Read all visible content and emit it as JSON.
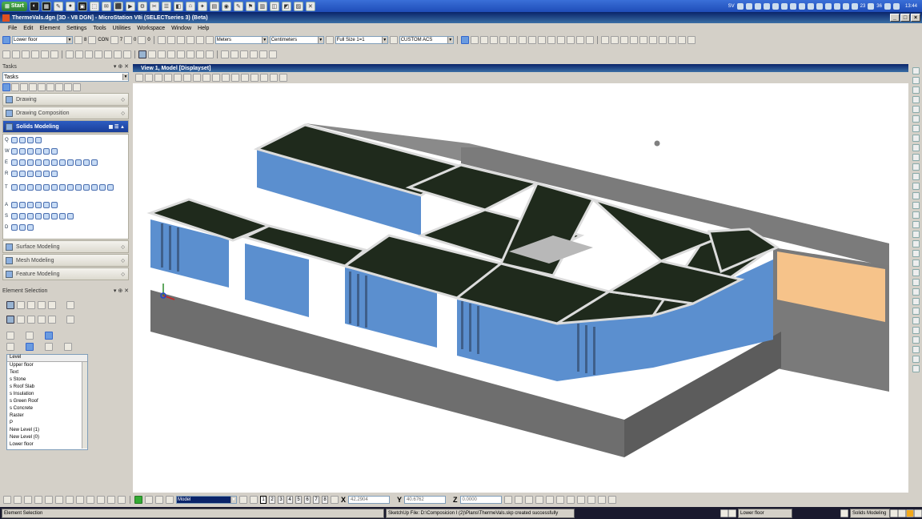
{
  "taskbar": {
    "start_label": "Start",
    "clock": "13:44",
    "lang": "SV",
    "tray_numbers": [
      "23",
      "36"
    ]
  },
  "window": {
    "title": "ThermeVals.dgn [3D - V8 DGN] - MicroStation V8i (SELECTseries 3) (Beta)"
  },
  "menu": [
    "File",
    "Edit",
    "Element",
    "Settings",
    "Tools",
    "Utilities",
    "Workspace",
    "Window",
    "Help"
  ],
  "attributes_toolbar": {
    "level_value": "Lower floor",
    "color_value": "8",
    "style_value": "CON",
    "weight_value": "7",
    "transparency_value": "0",
    "priority_value": "0"
  },
  "units_toolbar": {
    "master_units": "Meters",
    "sub_units": "Centimeters",
    "scale": "Full Size 1=1",
    "acs": "CUSTOM ACS"
  },
  "tasks_panel": {
    "header": "Tasks",
    "dropdown_value": "Tasks",
    "sections": [
      {
        "label": "Drawing",
        "active": false
      },
      {
        "label": "Drawing Composition",
        "active": false
      },
      {
        "label": "Solids Modeling",
        "active": true
      },
      {
        "label": "Surface Modeling",
        "active": false
      },
      {
        "label": "Mesh Modeling",
        "active": false
      },
      {
        "label": "Feature Modeling",
        "active": false
      }
    ],
    "solids_rows": [
      "Q",
      "W",
      "E",
      "R",
      "T",
      "A",
      "S",
      "D"
    ]
  },
  "element_selection": {
    "header": "Element Selection",
    "level_header": "Level",
    "levels": [
      "Upper floor",
      "Text",
      "s Stone",
      "s Roof Slab",
      "s Insulation",
      "s Green Roof",
      "s Concrete",
      "Raster",
      "P",
      "New Level (1)",
      "New Level (0)",
      "Lower floor"
    ]
  },
  "view": {
    "title": "View 1, Model [Displayset]"
  },
  "bottom_toolbar": {
    "model_value": "Model",
    "view_numbers": [
      "1",
      "2",
      "3",
      "4",
      "5",
      "6",
      "7",
      "8"
    ],
    "x_label": "X",
    "x_value": "42.2904",
    "y_label": "Y",
    "y_value": "40.6762",
    "z_label": "Z",
    "z_value": "0.0000"
  },
  "status_bar": {
    "left": "Element Selection",
    "message": "SketchUp File: D:\\Composicion I (2)\\Plans\\ThermeVals.skp created successfully",
    "level": "Lower floor",
    "task": "Solids Modeling"
  },
  "colors": {
    "roof": "#1f2a1c",
    "wall_blue": "#5b8fcf",
    "base_grey": "#6e6e6e",
    "orange": "#f6c38a",
    "title_blue": "#0a246a"
  }
}
